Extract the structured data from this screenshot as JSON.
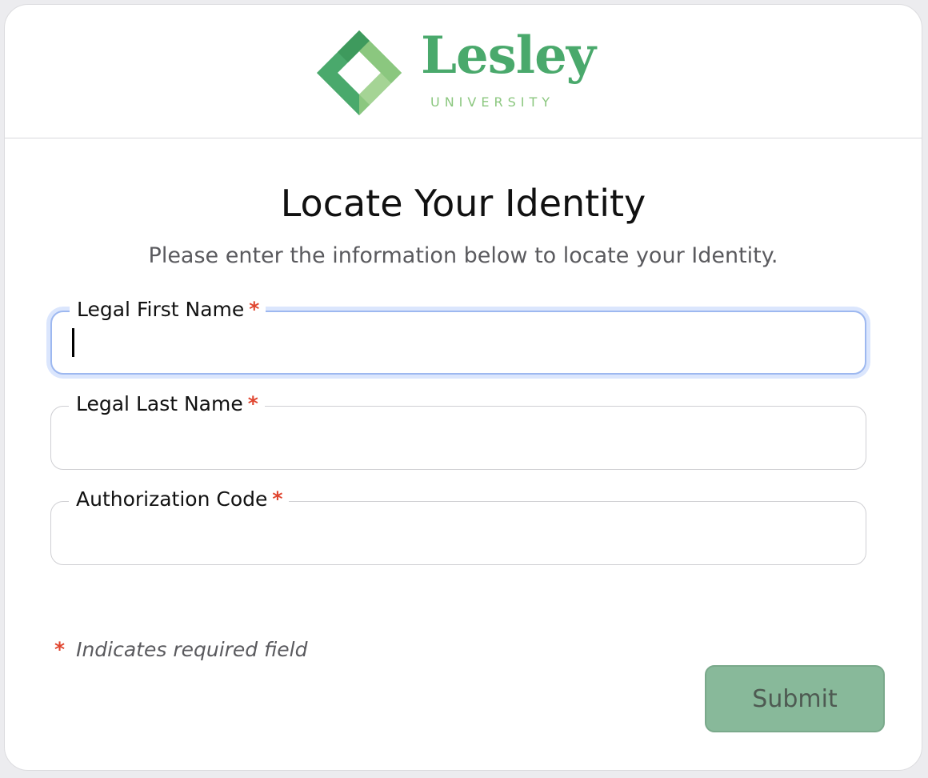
{
  "brand": {
    "name": "Lesley",
    "subtitle": "UNIVERSITY",
    "colors": {
      "primary": "#4aa96c",
      "light": "#8bc77f",
      "dark": "#3e9a5d"
    }
  },
  "page": {
    "title": "Locate Your Identity",
    "subtitle": "Please enter the information below to locate your Identity."
  },
  "form": {
    "required_marker": "*",
    "fields": [
      {
        "label": "Legal First Name",
        "value": "",
        "focused": true
      },
      {
        "label": "Legal Last Name",
        "value": ""
      },
      {
        "label": "Authorization Code",
        "value": ""
      }
    ],
    "required_note": "Indicates required field",
    "submit_label": "Submit"
  },
  "colors": {
    "required": "#e0452f",
    "focus_ring": "#9db8f0",
    "submit_bg": "#88b99a"
  }
}
